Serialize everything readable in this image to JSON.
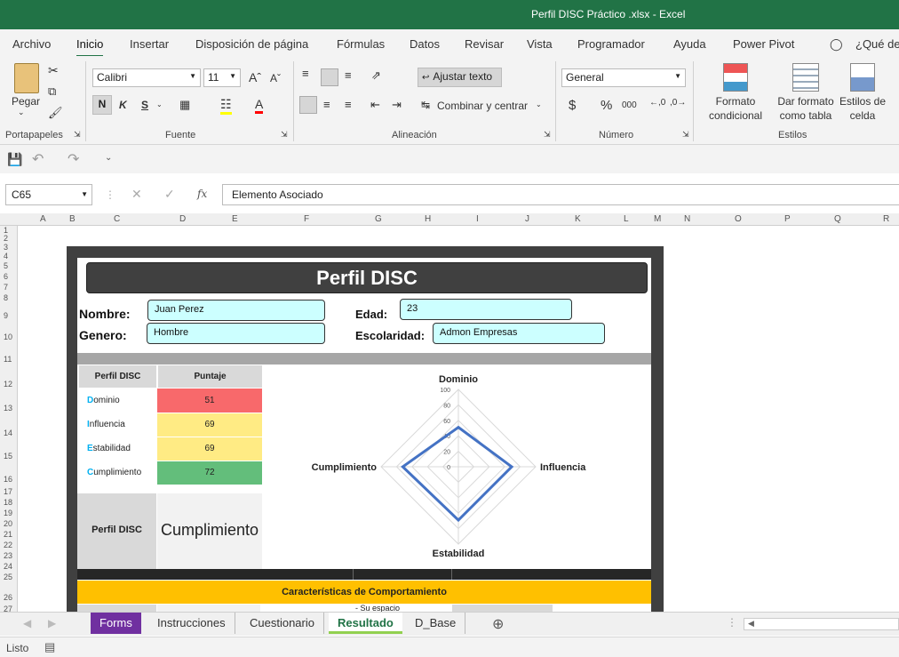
{
  "window": {
    "title": "Perfil DISC Práctico .xlsx  -  Excel"
  },
  "menu": [
    "Archivo",
    "Inicio",
    "Insertar",
    "Disposición de página",
    "Fórmulas",
    "Datos",
    "Revisar",
    "Vista",
    "Programador",
    "Ayuda",
    "Power Pivot",
    "¿Qué de"
  ],
  "ribbon": {
    "paste": "Pegar",
    "font_name": "Calibri",
    "font_size": "11",
    "bold": "N",
    "italic": "K",
    "underline": "S",
    "wrap_text": "Ajustar texto",
    "merge_center": "Combinar y centrar",
    "number_format": "General",
    "currency": "$",
    "percent": "%",
    "thousands": "000",
    "cond_format": "Formato condicional",
    "table_format": "Dar formato como tabla",
    "cell_styles": "Estilos de celda",
    "groups": [
      "Portapapeles",
      "Fuente",
      "Alineación",
      "Número",
      "Estilos"
    ]
  },
  "formula_bar": {
    "name_box": "C65",
    "fx": "fx",
    "content": "Elemento Asociado"
  },
  "columns": [
    "A",
    "B",
    "C",
    "D",
    "E",
    "F",
    "G",
    "H",
    "I",
    "J",
    "K",
    "L",
    "M",
    "N",
    "O",
    "P",
    "Q",
    "R"
  ],
  "rows": [
    "1",
    "2",
    "3",
    "4",
    "5",
    "6",
    "7",
    "8",
    "9",
    "10",
    "11",
    "12",
    "13",
    "14",
    "15",
    "16",
    "17",
    "18",
    "19",
    "20",
    "21",
    "22",
    "23",
    "24",
    "25",
    "26",
    "27"
  ],
  "sheet": {
    "title": "Perfil DISC",
    "name_label": "Nombre:",
    "name_value": "Juan Perez",
    "gender_label": "Genero:",
    "gender_value": "Hombre",
    "age_label": "Edad:",
    "age_value": "23",
    "school_label": "Escolaridad:",
    "school_value": "Admon Empresas",
    "table_header": {
      "col1": "Perfil DISC",
      "col2": "Puntaje"
    },
    "table_rows": [
      {
        "initial": "D",
        "rest": "ominio",
        "score": "51",
        "color": "#f8696b"
      },
      {
        "initial": "I",
        "rest": "nfluencia",
        "score": "69",
        "color": "#ffeb84"
      },
      {
        "initial": "E",
        "rest": "stabilidad",
        "score": "69",
        "color": "#ffeb84"
      },
      {
        "initial": "C",
        "rest": "umplimiento",
        "score": "72",
        "color": "#63be7b"
      }
    ],
    "profile_label": "Perfil DISC",
    "profile_value": "Cumplimiento",
    "behavior_header": "Características de Comportamiento",
    "cut_text": "- Su espacio"
  },
  "chart_data": {
    "type": "radar",
    "categories": [
      "Dominio",
      "Influencia",
      "Estabilidad",
      "Cumplimiento"
    ],
    "values": [
      51,
      69,
      69,
      72
    ],
    "axis_ticks": [
      "0",
      "20",
      "40",
      "60",
      "80",
      "100"
    ],
    "range": [
      0,
      100
    ],
    "series_color": "#4472c4"
  },
  "tabs": [
    "Forms",
    "Instrucciones",
    "Cuestionario",
    "Resultado",
    "D_Base"
  ],
  "active_tab": "Resultado",
  "status": "Listo"
}
